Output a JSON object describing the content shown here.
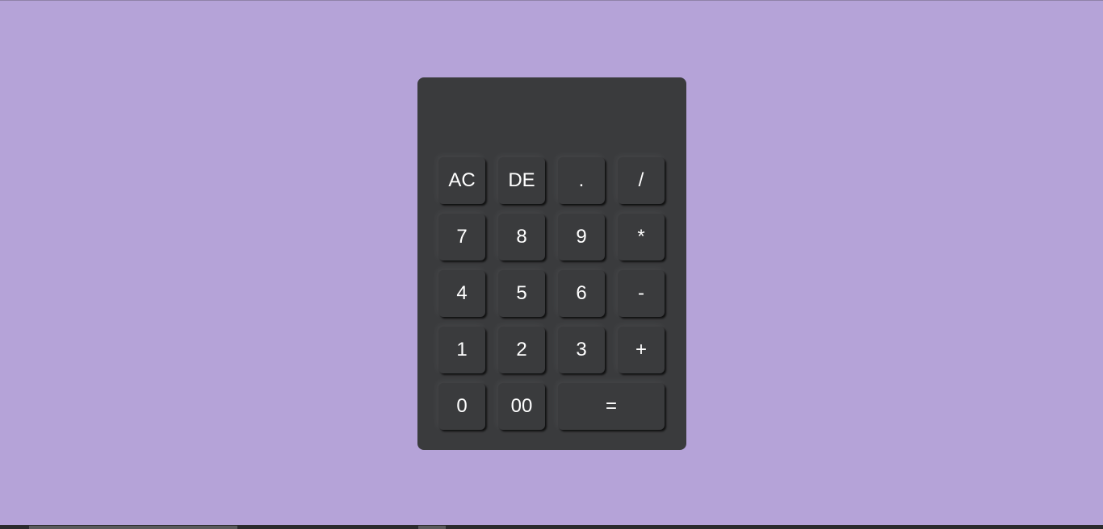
{
  "colors": {
    "background": "#b5a3d8",
    "calculator_body": "#3a3b3d",
    "button_text": "#ffffff"
  },
  "display": {
    "value": ""
  },
  "buttons": {
    "all_clear": "AC",
    "delete": "DE",
    "decimal": ".",
    "divide": "/",
    "seven": "7",
    "eight": "8",
    "nine": "9",
    "multiply": "*",
    "four": "4",
    "five": "5",
    "six": "6",
    "subtract": "-",
    "one": "1",
    "two": "2",
    "three": "3",
    "add": "+",
    "zero": "0",
    "double_zero": "00",
    "equals": "="
  }
}
